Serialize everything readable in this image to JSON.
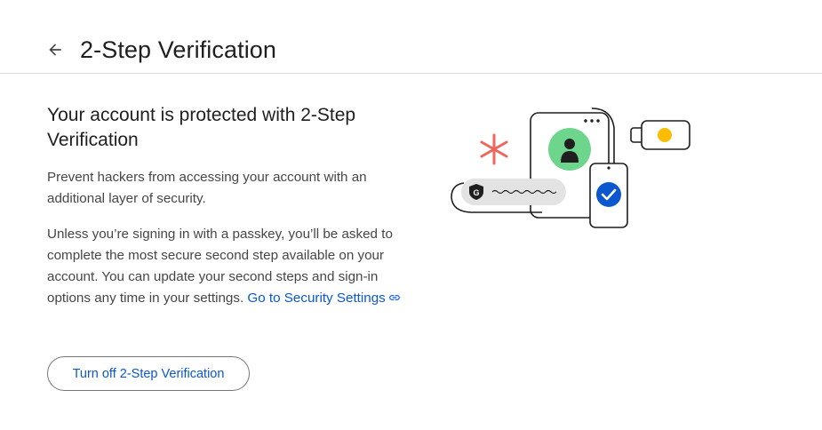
{
  "header": {
    "back_icon": "arrow-back-icon",
    "title": "2-Step Verification"
  },
  "main": {
    "heading": "Your account is protected with 2-Step Verification",
    "paragraph1": "Prevent hackers from accessing your account with an additional layer of security.",
    "paragraph2": "Unless you’re signing in with a passkey, you’ll be asked to complete the most secure second step available on your account. You can update your second steps and sign-in options any time in your settings.",
    "security_link": "Go to Security Settings",
    "link_icon": "link-icon",
    "turn_off_button": "Turn off 2-Step Verification"
  },
  "illustration": {
    "icons": [
      "asterisk-icon",
      "avatar-icon",
      "google-shield-icon",
      "checkmark-icon",
      "security-key-icon"
    ],
    "colors": {
      "accent_red": "#ee675c",
      "avatar_green": "#6dd58c",
      "check_blue": "#0b57d0",
      "key_yellow": "#fbbc04",
      "pill_gray": "#e3e3e3"
    }
  }
}
